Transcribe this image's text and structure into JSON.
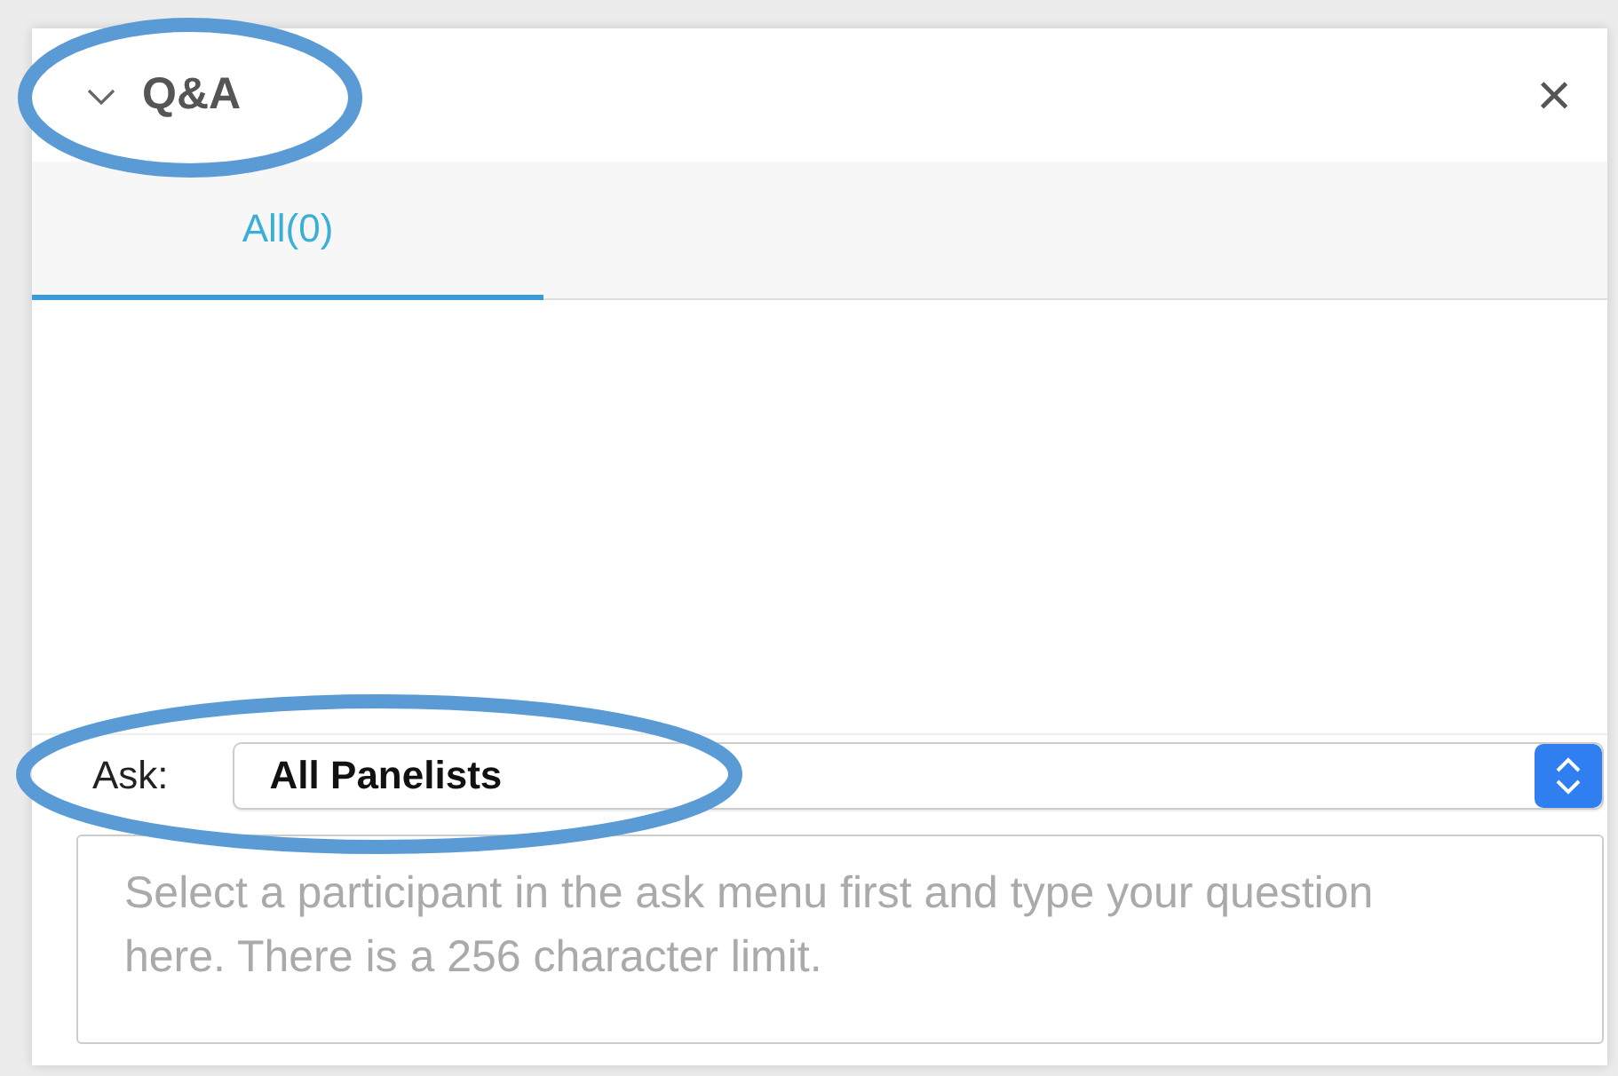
{
  "panel": {
    "title": "Q&A",
    "close_glyph": "×"
  },
  "tabs": [
    {
      "label": "All(0)",
      "selected": true
    }
  ],
  "ask": {
    "label": "Ask:",
    "value": "All Panelists"
  },
  "question_field": {
    "placeholder": "Select a participant in the ask menu first and type your question here. There is a 256 character limit."
  },
  "annotations": [
    {
      "kind": "ellipse"
    },
    {
      "kind": "ellipse"
    }
  ]
}
